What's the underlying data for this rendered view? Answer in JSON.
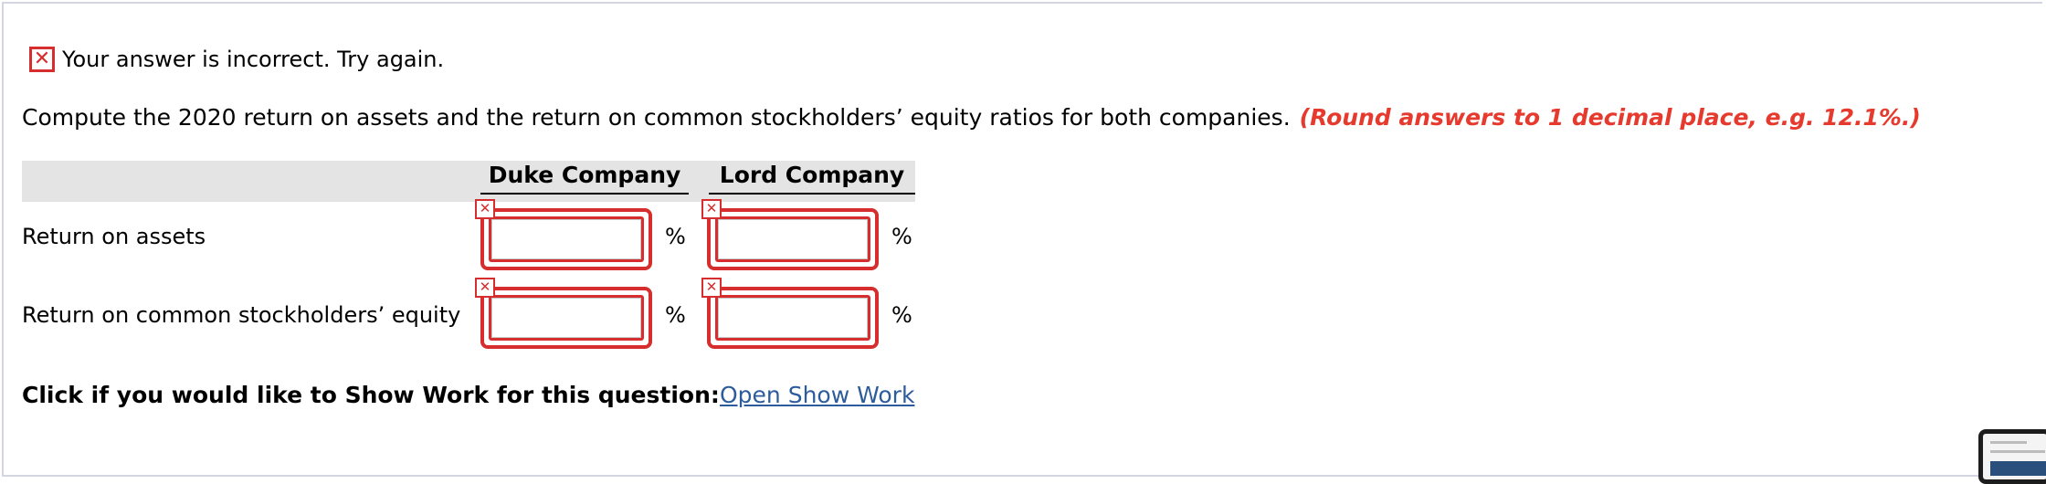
{
  "status": {
    "message": "Your answer is incorrect.  Try again.",
    "icon": "error-x-icon",
    "color": "#d62e2e"
  },
  "question": {
    "prompt": "Compute the 2020 return on assets and the return on common stockholders’ equity ratios for both companies.",
    "rounding_note": "(Round answers to 1 decimal place, e.g. 12.1%.)",
    "note_color": "#e53a2d"
  },
  "table": {
    "columns": [
      "Duke Company",
      "Lord Company"
    ],
    "rows": [
      {
        "label": "Return on assets",
        "values": [
          "",
          ""
        ],
        "unit": "%"
      },
      {
        "label": "Return on common stockholders’ equity",
        "values": [
          "",
          ""
        ],
        "unit": "%"
      }
    ]
  },
  "show_work": {
    "label": "Click if you would like to Show Work for this question:",
    "link": "Open Show Work",
    "link_color": "#2c5c9c"
  }
}
